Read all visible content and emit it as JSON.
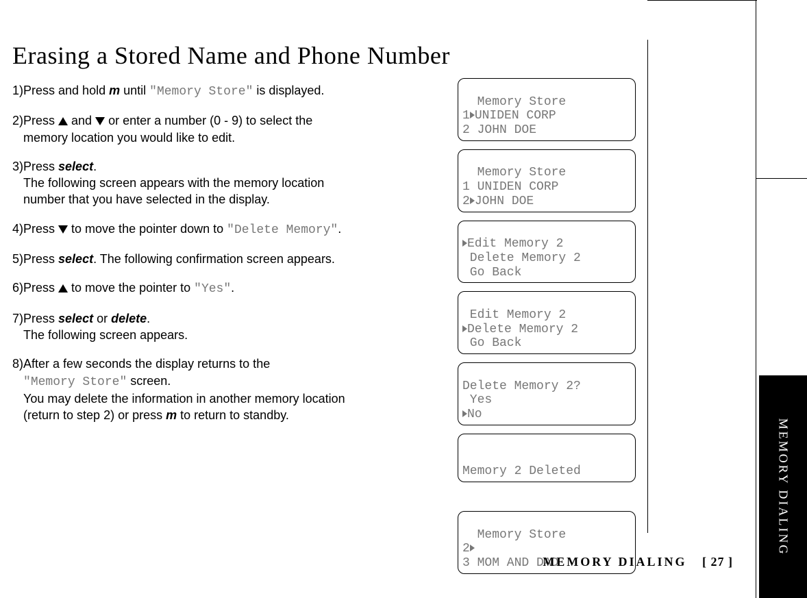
{
  "title": "Erasing a Stored Name and Phone Number",
  "steps": {
    "s1": {
      "n": "1)",
      "a": "Press and hold ",
      "m": "m",
      "b": " until ",
      "lcd": "\"Memory Store\"",
      "c": " is displayed."
    },
    "s2": {
      "n": "2)",
      "a": "Press ",
      "mid": " and ",
      "b": " or enter a number (0 - 9) to select the",
      "l2": "memory location you would like to edit."
    },
    "s3": {
      "n": "3)",
      "a": "Press ",
      "kw": "select",
      "b": ".",
      "l2": "The following screen appears with the memory location",
      "l3": "number that you have selected in the display."
    },
    "s4": {
      "n": "4)",
      "a": "Press ",
      "b": " to move the pointer down to ",
      "lcd": "\"Delete Memory\"",
      "c": "."
    },
    "s5": {
      "n": "5)",
      "a": "Press ",
      "kw": "select",
      "b": ". The following confirmation screen appears."
    },
    "s6": {
      "n": "6)",
      "a": "Press ",
      "b": " to move the pointer to ",
      "lcd": "\"Yes\"",
      "c": "."
    },
    "s7": {
      "n": "7)",
      "a": "Press ",
      "kw1": "select",
      "or": " or ",
      "kw2": "delete",
      "b": ".",
      "l2": "The following screen appears."
    },
    "s8": {
      "n": "8)",
      "a": "After a few seconds the display returns to the",
      "lcd": "\"Memory Store\"",
      "l2b": " screen.",
      "l3": "You may delete the information in another memory location",
      "l4a": "(return to step 2) or press ",
      "m": "m",
      "l4b": " to return to standby."
    }
  },
  "screens": {
    "sc1": {
      "l1": "  Memory Store",
      "l2a": "1",
      "l2b": "UNIDEN CORP",
      "l3": "2 JOHN DOE"
    },
    "sc2": {
      "l1": "  Memory Store",
      "l2": "1 UNIDEN CORP",
      "l3a": "2",
      "l3b": "JOHN DOE"
    },
    "sc3": {
      "l1b": "Edit Memory 2",
      "l2": " Delete Memory 2",
      "l3": " Go Back"
    },
    "sc4": {
      "l1": " Edit Memory 2",
      "l2b": "Delete Memory 2",
      "l3": " Go Back"
    },
    "sc5": {
      "l1": "Delete Memory 2?",
      "l2": " Yes",
      "l3b": "No"
    },
    "sc6": {
      "l1": "",
      "l2": "Memory 2 Deleted",
      "l3": ""
    },
    "sc7": {
      "l1": "  Memory Store",
      "l2a": "2",
      "l3": "3 MOM AND DAD"
    }
  },
  "footer": {
    "label": "MEMORY DIALING",
    "page": "[ 27 ]"
  },
  "sidetab": "MEMORY DIALING"
}
